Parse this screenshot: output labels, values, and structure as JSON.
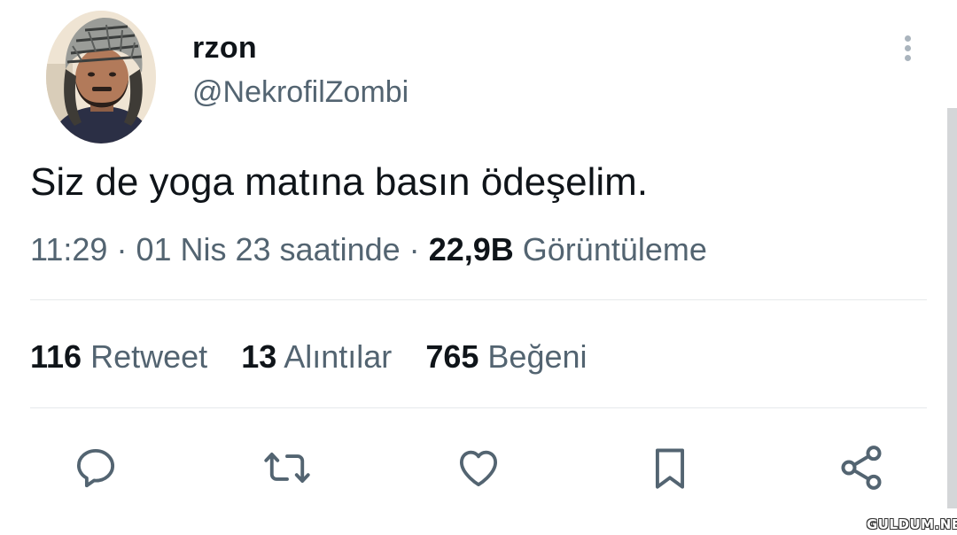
{
  "author": {
    "display_name": "rzon",
    "handle": "@NekrofilZombi"
  },
  "tweet": {
    "text": "Siz de yoga matına basın ödeşelim."
  },
  "meta": {
    "time": "11:29",
    "sep1": "·",
    "date": "01 Nis 23 saatinde",
    "sep2": "·",
    "views_count": "22,9B",
    "views_label": "Görüntüleme"
  },
  "stats": {
    "retweets_count": "116",
    "retweets_label": "Retweet",
    "quotes_count": "13",
    "quotes_label": "Alıntılar",
    "likes_count": "765",
    "likes_label": "Beğeni"
  },
  "actions": [
    {
      "icon": "reply-icon"
    },
    {
      "icon": "retweet-icon"
    },
    {
      "icon": "like-icon"
    },
    {
      "icon": "bookmark-icon"
    },
    {
      "icon": "share-icon"
    }
  ],
  "watermark": "GULDUM.NET",
  "colors": {
    "text_primary": "#0f1419",
    "text_secondary": "#536471",
    "icon": "#536471",
    "divider": "#e6e9eb"
  }
}
